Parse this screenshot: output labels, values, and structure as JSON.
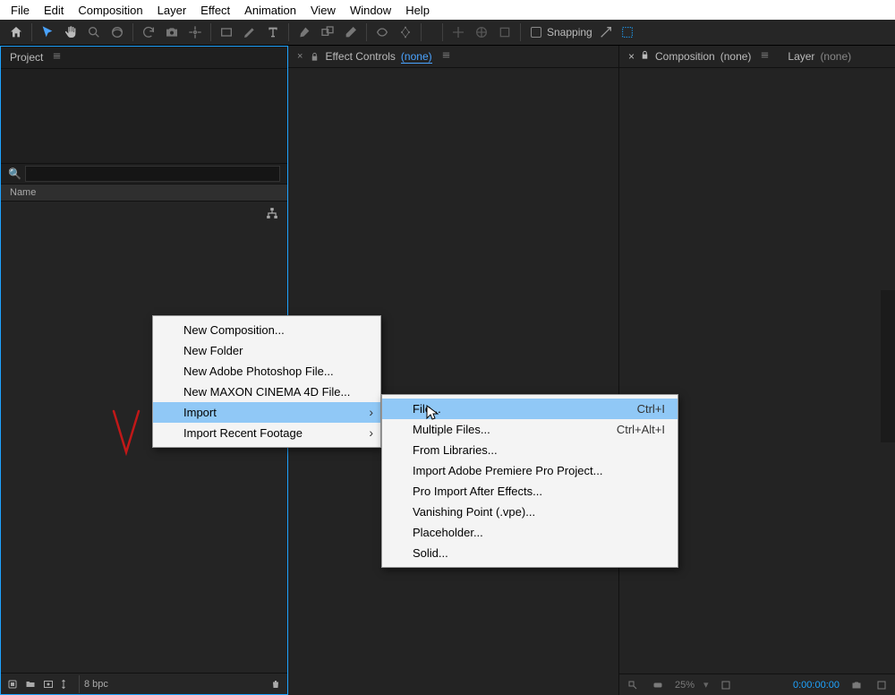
{
  "menu": {
    "file": "File",
    "edit": "Edit",
    "composition": "Composition",
    "layer": "Layer",
    "effect": "Effect",
    "animation": "Animation",
    "view": "View",
    "window": "Window",
    "help": "Help"
  },
  "toolbar": {
    "snapping_label": "Snapping"
  },
  "panels": {
    "project_title": "Project",
    "name_col": "Name",
    "bpc": "8 bpc",
    "search_placeholder": ""
  },
  "effect_panel": {
    "title": "Effect Controls",
    "link": "(none)"
  },
  "comp_panel": {
    "title": "Composition",
    "link": "(none)",
    "layer_title": "Layer",
    "layer_link": "(none)"
  },
  "viewer_footer": {
    "zoom": "25%",
    "timecode": "0:00:00:00"
  },
  "context_menu1": {
    "items": [
      "New Composition...",
      "New Folder",
      "New Adobe Photoshop File...",
      "New MAXON CINEMA 4D File...",
      "Import",
      "Import Recent Footage"
    ]
  },
  "context_menu2": {
    "items": [
      {
        "label": "File...",
        "shortcut": "Ctrl+I"
      },
      {
        "label": "Multiple Files...",
        "shortcut": "Ctrl+Alt+I"
      },
      {
        "label": "From Libraries...",
        "shortcut": ""
      },
      {
        "label": "Import Adobe Premiere Pro Project...",
        "shortcut": ""
      },
      {
        "label": "Pro Import After Effects...",
        "shortcut": ""
      },
      {
        "label": "Vanishing Point (.vpe)...",
        "shortcut": ""
      },
      {
        "label": "Placeholder...",
        "shortcut": ""
      },
      {
        "label": "Solid...",
        "shortcut": ""
      }
    ]
  }
}
